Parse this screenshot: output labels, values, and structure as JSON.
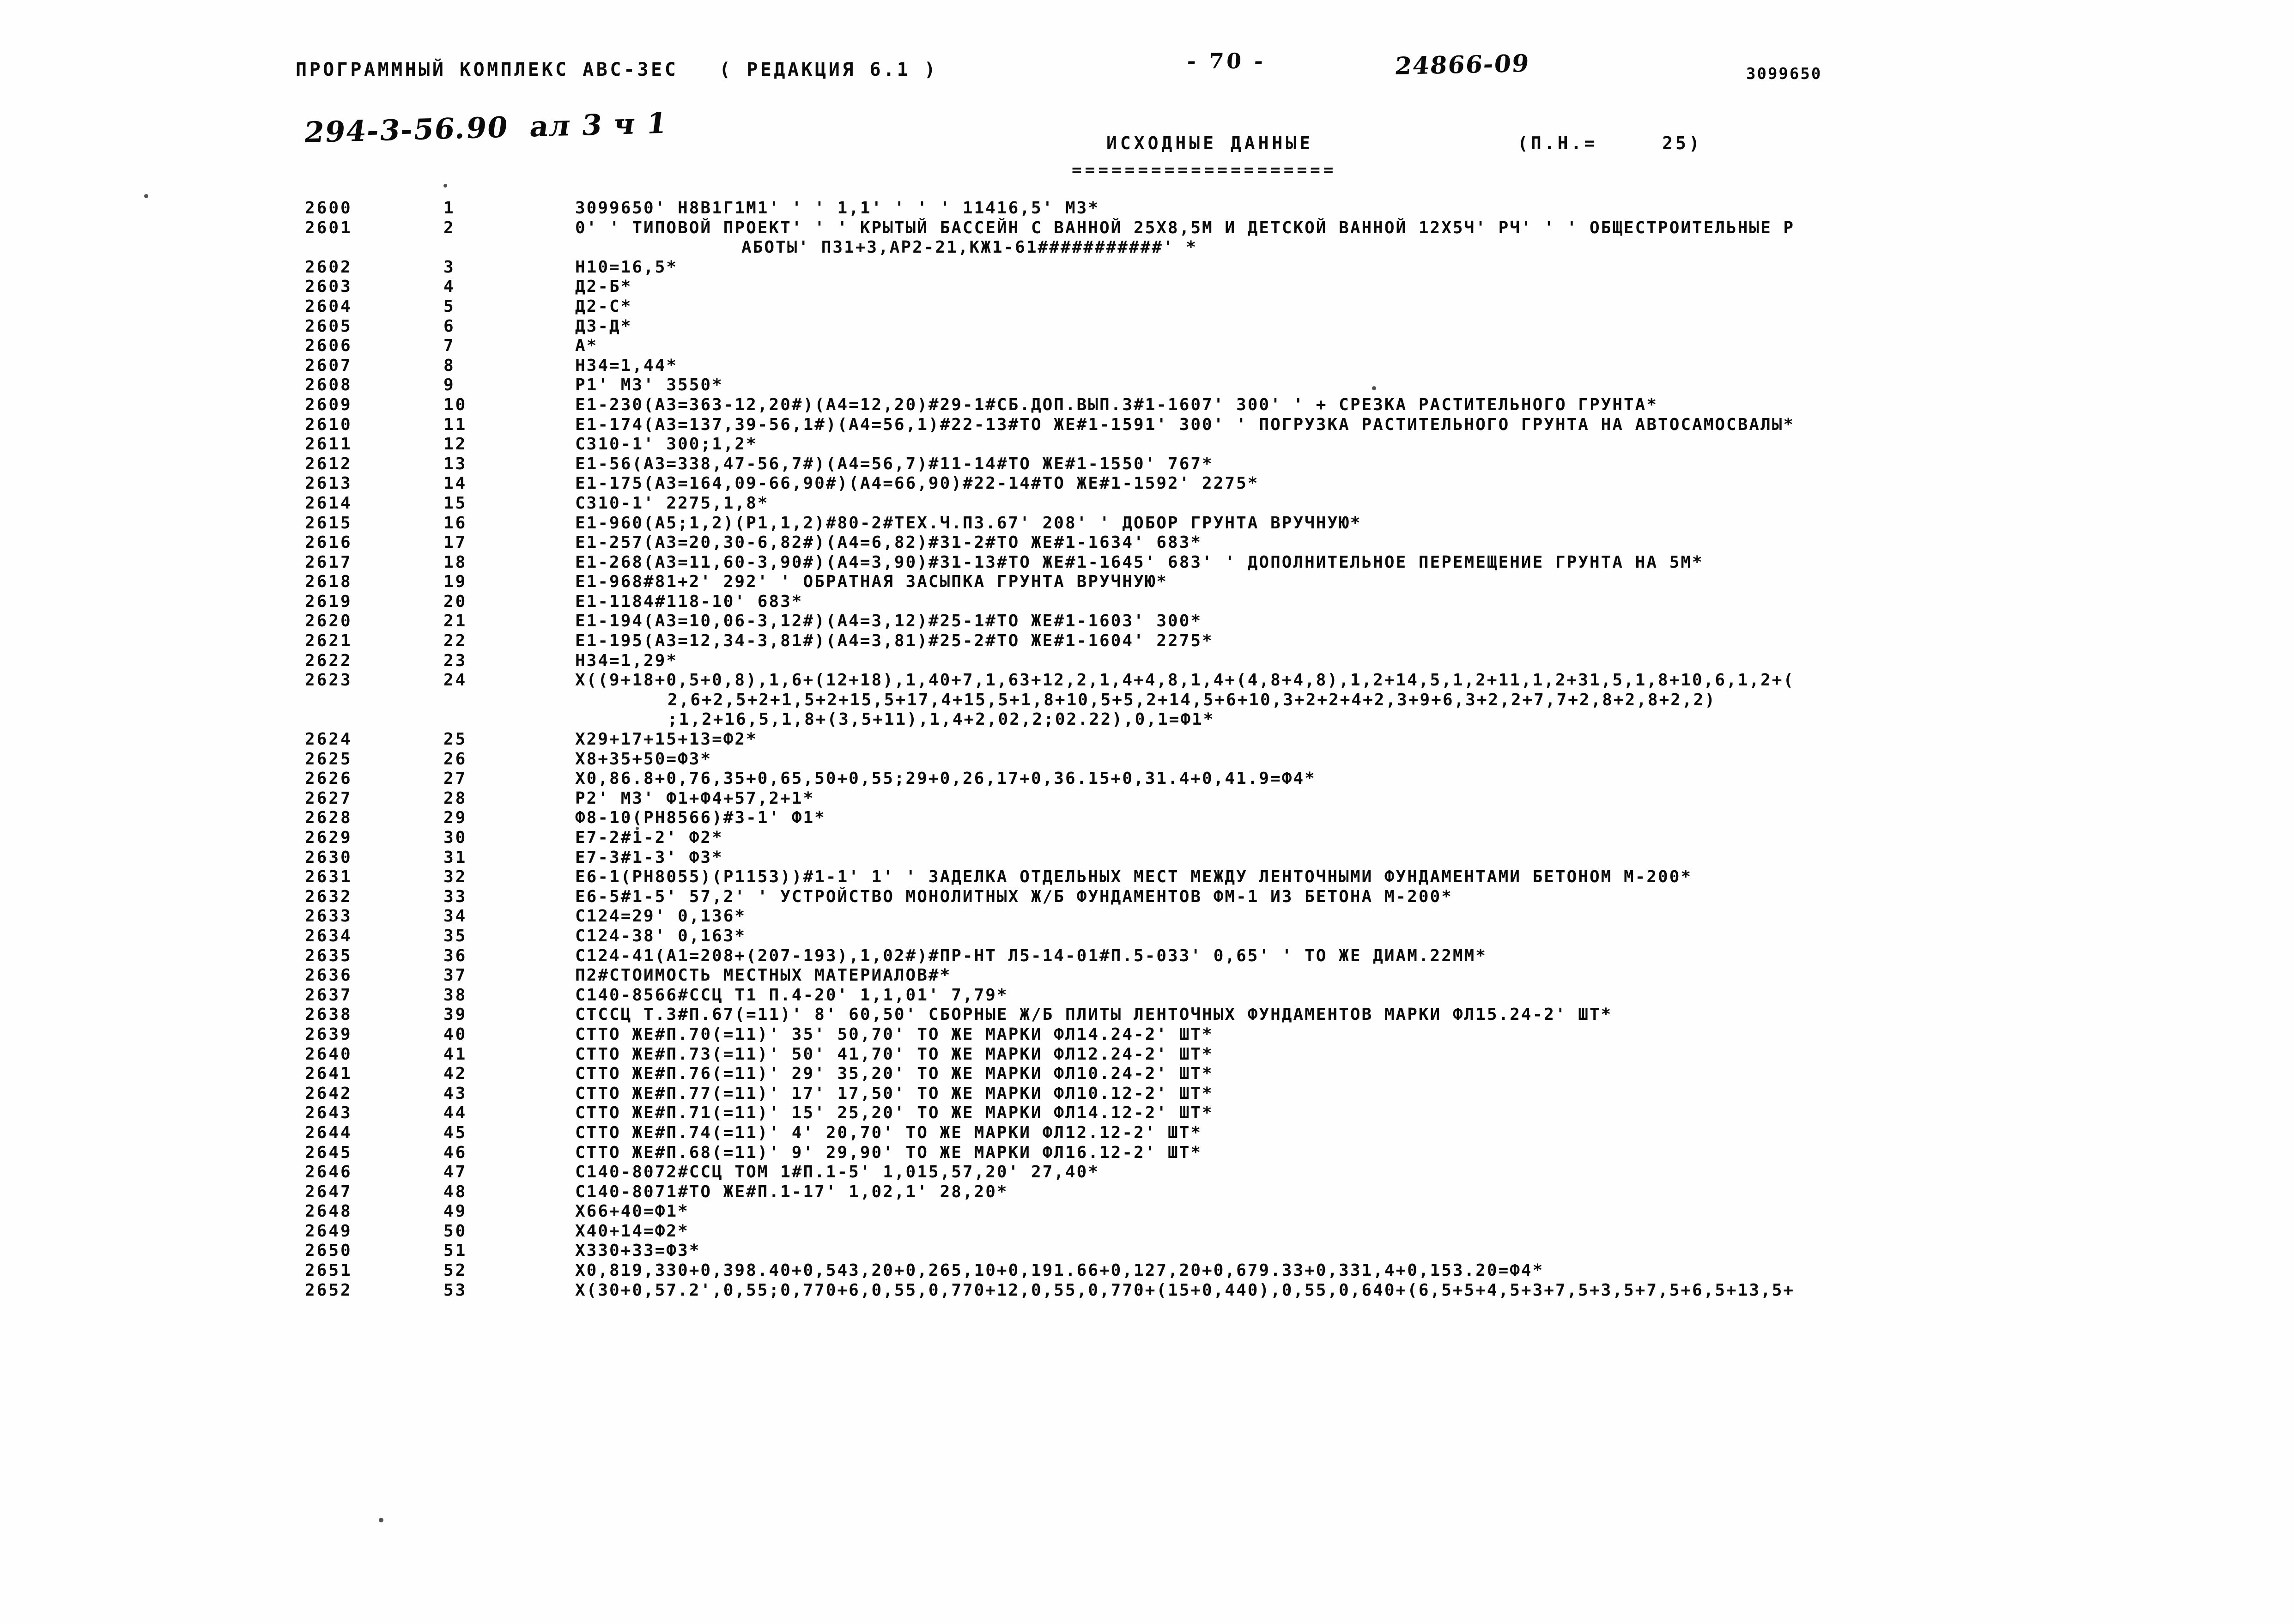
{
  "header": {
    "program_line": "ПРОГРАММНЫЙ КОМПЛЕКС АВС-3ЕС   ( РЕДАКЦИЯ 6.1 )",
    "page_number": "- 70 -",
    "doc_code": "24866-09",
    "object_code": "3099650",
    "handwritten_note": "294-3-56.90  ал 3 ч 1",
    "title": "ИСХОДНЫЕ ДАННЫЕ",
    "pn_label": "(П.Н.=",
    "pn_value": "25)",
    "rule": "===================="
  },
  "listing": {
    "rows": [
      {
        "line": "2600",
        "seq": "1",
        "text": "3099650' Н8В1Г1М1' ' ' 1,1' ' ' ' 11416,5' М3*"
      },
      {
        "line": "2601",
        "seq": "2",
        "text": "0' ' ТИПОВОЙ ПРОЕКТ' ' ' КРЫТЫЙ БАССЕЙН С ВАННОЙ 25Х8,5М И ДЕТСКОЙ ВАННОЙ 12Х5Ч' РЧ' ' ' ОБЩЕСТРОИТЕЛЬНЫЕ Р"
      },
      {
        "line": "",
        "seq": "",
        "text": "АБОТЫ' ПЗ1+3,АР2-21,КЖ1-61###########' *",
        "indent": "ind1"
      },
      {
        "line": "2602",
        "seq": "3",
        "text": "Н10=16,5*"
      },
      {
        "line": "2603",
        "seq": "4",
        "text": "Д2-Б*"
      },
      {
        "line": "2604",
        "seq": "5",
        "text": "Д2-С*"
      },
      {
        "line": "2605",
        "seq": "6",
        "text": "Д3-Д*"
      },
      {
        "line": "2606",
        "seq": "7",
        "text": "А*"
      },
      {
        "line": "2607",
        "seq": "8",
        "text": "Н34=1,44*"
      },
      {
        "line": "2608",
        "seq": "9",
        "text": "Р1' М3' 3550*"
      },
      {
        "line": "2609",
        "seq": "10",
        "text": "Е1-230(А3=363-12,20#)(А4=12,20)#29-1#СБ.ДОП.ВЫП.3#1-1607' 300' ' + СРЕЗКА РАСТИТЕЛЬНОГО ГРУНТА*"
      },
      {
        "line": "2610",
        "seq": "11",
        "text": "Е1-174(А3=137,39-56,1#)(А4=56,1)#22-13#ТО ЖЕ#1-1591' 300' ' ПОГРУЗКА РАСТИТЕЛЬНОГО ГРУНТА НА АВТОСАМОСВАЛЫ*"
      },
      {
        "line": "2611",
        "seq": "12",
        "text": "С310-1' 300;1,2*"
      },
      {
        "line": "2612",
        "seq": "13",
        "text": "Е1-56(А3=338,47-56,7#)(А4=56,7)#11-14#ТО ЖЕ#1-1550' 767*"
      },
      {
        "line": "2613",
        "seq": "14",
        "text": "Е1-175(А3=164,09-66,90#)(А4=66,90)#22-14#ТО ЖЕ#1-1592' 2275*"
      },
      {
        "line": "2614",
        "seq": "15",
        "text": "С310-1' 2275,1,8*"
      },
      {
        "line": "2615",
        "seq": "16",
        "text": "Е1-960(А5;1,2)(Р1,1,2)#80-2#ТЕХ.Ч.ПЗ.67' 208' ' ДОБОР ГРУНТА ВРУЧНУЮ*"
      },
      {
        "line": "2616",
        "seq": "17",
        "text": "Е1-257(А3=20,30-6,82#)(А4=6,82)#31-2#ТО ЖЕ#1-1634' 683*"
      },
      {
        "line": "2617",
        "seq": "18",
        "text": "Е1-268(А3=11,60-3,90#)(А4=3,90)#31-13#ТО ЖЕ#1-1645' 683' ' ДОПОЛНИТЕЛЬНОЕ ПЕРЕМЕЩЕНИЕ ГРУНТА НА 5М*"
      },
      {
        "line": "2618",
        "seq": "19",
        "text": "Е1-968#81+2' 292' ' ОБРАТНАЯ ЗАСЫПКА ГРУНТА ВРУЧНУЮ*"
      },
      {
        "line": "2619",
        "seq": "20",
        "text": "Е1-1184#118-10' 683*"
      },
      {
        "line": "2620",
        "seq": "21",
        "text": "Е1-194(А3=10,06-3,12#)(А4=3,12)#25-1#ТО ЖЕ#1-1603' 300*"
      },
      {
        "line": "2621",
        "seq": "22",
        "text": "Е1-195(А3=12,34-3,81#)(А4=3,81)#25-2#ТО ЖЕ#1-1604' 2275*"
      },
      {
        "line": "2622",
        "seq": "23",
        "text": "Н34=1,29*"
      },
      {
        "line": "2623",
        "seq": "24",
        "text": "Х((9+18+0,5+0,8),1,6+(12+18),1,40+7,1,63+12,2,1,4+4,8,1,4+(4,8+4,8),1,2+14,5,1,2+11,1,2+31,5,1,8+10,6,1,2+("
      },
      {
        "line": "",
        "seq": "",
        "text": "2,6+2,5+2+1,5+2+15,5+17,4+15,5+1,8+10,5+5,2+14,5+6+10,3+2+2+4+2,3+9+6,3+2,2+7,7+2,8+2,8+2,2)",
        "indent": "ind2"
      },
      {
        "line": "",
        "seq": "",
        "text": ";1,2+16,5,1,8+(3,5+11),1,4+2,02,2;02.22),0,1=Ф1*",
        "indent": "ind2"
      },
      {
        "line": "2624",
        "seq": "25",
        "text": "Х29+17+15+13=Ф2*"
      },
      {
        "line": "2625",
        "seq": "26",
        "text": "Х8+35+50=Ф3*"
      },
      {
        "line": "2626",
        "seq": "27",
        "text": "Х0,86.8+0,76,35+0,65,50+0,55;29+0,26,17+0,36.15+0,31.4+0,41.9=Ф4*"
      },
      {
        "line": "2627",
        "seq": "28",
        "text": "Р2' М3' Ф1+Ф4+57,2+1*"
      },
      {
        "line": "2628",
        "seq": "29",
        "text": "Ф8-10(РН8566)#3-1' Ф1*"
      },
      {
        "line": "2629",
        "seq": "30",
        "text": "Е7-2#1-2' Ф2*"
      },
      {
        "line": "2630",
        "seq": "31",
        "text": "Е7-3#1-3' Ф3*"
      },
      {
        "line": "2631",
        "seq": "32",
        "text": "Е6-1(РН8055)(Р1153))#1-1' 1' ' ЗАДЕЛКА ОТДЕЛЬНЫХ МЕСТ МЕЖДУ ЛЕНТОЧНЫМИ ФУНДАМЕНТАМИ БЕТОНОМ М-200*"
      },
      {
        "line": "2632",
        "seq": "33",
        "text": "Е6-5#1-5' 57,2' ' УСТРОЙСТВО МОНОЛИТНЫХ Ж/Б ФУНДАМЕНТОВ ФМ-1 ИЗ БЕТОНА М-200*"
      },
      {
        "line": "2633",
        "seq": "34",
        "text": "С124=29' 0,136*"
      },
      {
        "line": "2634",
        "seq": "35",
        "text": "С124-38' 0,163*"
      },
      {
        "line": "2635",
        "seq": "36",
        "text": "С124-41(А1=208+(207-193),1,02#)#ПР-НТ Л5-14-01#П.5-033' 0,65' ' ТО ЖЕ ДИАМ.22ММ*"
      },
      {
        "line": "2636",
        "seq": "37",
        "text": "П2#СТОИМОСТЬ МЕСТНЫХ МАТЕРИАЛОВ#*"
      },
      {
        "line": "2637",
        "seq": "38",
        "text": "С140-8566#ССЦ Т1 П.4-20' 1,1,01' 7,79*"
      },
      {
        "line": "2638",
        "seq": "39",
        "text": "СТССЦ Т.3#П.67(=11)' 8' 60,50' СБОРНЫЕ Ж/Б ПЛИТЫ ЛЕНТОЧНЫХ ФУНДАМЕНТОВ МАРКИ ФЛ15.24-2' ШТ*"
      },
      {
        "line": "2639",
        "seq": "40",
        "text": "СТТО ЖЕ#П.70(=11)' 35' 50,70' ТО ЖЕ МАРКИ ФЛ14.24-2' ШТ*"
      },
      {
        "line": "2640",
        "seq": "41",
        "text": "СТТО ЖЕ#П.73(=11)' 50' 41,70' ТО ЖЕ МАРКИ ФЛ12.24-2' ШТ*"
      },
      {
        "line": "2641",
        "seq": "42",
        "text": "СТТО ЖЕ#П.76(=11)' 29' 35,20' ТО ЖЕ МАРКИ ФЛ10.24-2' ШТ*"
      },
      {
        "line": "2642",
        "seq": "43",
        "text": "СТТО ЖЕ#П.77(=11)' 17' 17,50' ТО ЖЕ МАРКИ ФЛ10.12-2' ШТ*"
      },
      {
        "line": "2643",
        "seq": "44",
        "text": "СТТО ЖЕ#П.71(=11)' 15' 25,20' ТО ЖЕ МАРКИ ФЛ14.12-2' ШТ*"
      },
      {
        "line": "2644",
        "seq": "45",
        "text": "СТТО ЖЕ#П.74(=11)' 4' 20,70' ТО ЖЕ МАРКИ ФЛ12.12-2' ШТ*"
      },
      {
        "line": "2645",
        "seq": "46",
        "text": "СТТО ЖЕ#П.68(=11)' 9' 29,90' ТО ЖЕ МАРКИ ФЛ16.12-2' ШТ*"
      },
      {
        "line": "2646",
        "seq": "47",
        "text": "С140-8072#ССЦ ТОМ 1#П.1-5' 1,015,57,20' 27,40*"
      },
      {
        "line": "2647",
        "seq": "48",
        "text": "С140-8071#ТО ЖЕ#П.1-17' 1,02,1' 28,20*"
      },
      {
        "line": "2648",
        "seq": "49",
        "text": "Х66+40=Ф1*"
      },
      {
        "line": "2649",
        "seq": "50",
        "text": "Х40+14=Ф2*"
      },
      {
        "line": "2650",
        "seq": "51",
        "text": "Х330+33=Ф3*"
      },
      {
        "line": "2651",
        "seq": "52",
        "text": "Х0,819,330+0,398.40+0,543,20+0,265,10+0,191.66+0,127,20+0,679.33+0,331,4+0,153.20=Ф4*"
      },
      {
        "line": "2652",
        "seq": "53",
        "text": "Х(30+0,57.2',0,55;0,770+6,0,55,0,770+12,0,55,0,770+(15+0,440),0,55,0,640+(6,5+5+4,5+3+7,5+3,5+7,5+6,5+13,5+"
      }
    ]
  }
}
